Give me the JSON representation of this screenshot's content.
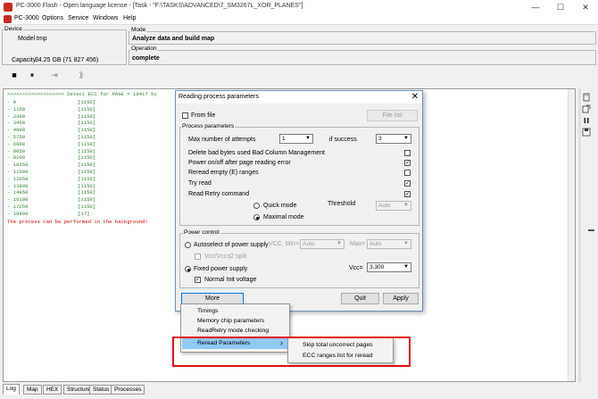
{
  "window": {
    "title": "PC-3000 Flash - Open language license - [Task - \"F:\\TASKS\\ADVANCED\\7_SM3267L_XOR_PLANES\"]",
    "minimize": "—",
    "maximize": "☐",
    "close": "✕"
  },
  "menubar": {
    "app_name": "PC-3000",
    "items": [
      "Options",
      "Service",
      "Windows",
      "Help"
    ]
  },
  "device": {
    "group_label": "Device",
    "model_label": "Model",
    "model_value": "tmp",
    "capacity_label": "Capacity",
    "capacity_value": "34.25 GB (71 827 456)"
  },
  "mode": {
    "group_label": "Mode",
    "value": "Analyze data and build map"
  },
  "operation": {
    "group_label": "Operation",
    "value": "complete"
  },
  "toolbar": {
    "stop": "■",
    "pause": "⏸",
    "step": "⇥",
    "run": "⟫"
  },
  "log": {
    "header": ">>>>>>>>>>>>>>>>>>> Detect ECC for PAGE = 18417 by",
    "rows": [
      {
        "n": "- 0",
        "v": "[1150]"
      },
      {
        "n": "- 1150",
        "v": "[1150]"
      },
      {
        "n": "- 2300",
        "v": "[1150]"
      },
      {
        "n": "- 3450",
        "v": "[1150]"
      },
      {
        "n": "- 4600",
        "v": "[1150]"
      },
      {
        "n": "- 5750",
        "v": "[1150]"
      },
      {
        "n": "- 6900",
        "v": "[1150]"
      },
      {
        "n": "- 8050",
        "v": "[1150]"
      },
      {
        "n": "- 9200",
        "v": "[1150]"
      },
      {
        "n": "- 10350",
        "v": "[1150]"
      },
      {
        "n": "- 11500",
        "v": "[1150]"
      },
      {
        "n": "- 12650",
        "v": "[1150]"
      },
      {
        "n": "- 13800",
        "v": "[1150]"
      },
      {
        "n": "- 14950",
        "v": "[1150]"
      },
      {
        "n": "- 16100",
        "v": "[1150]"
      },
      {
        "n": "- 17250",
        "v": "[1150]"
      },
      {
        "n": "- 18400",
        "v": "[17]"
      }
    ],
    "footer": "The process can be performed in the background!"
  },
  "bottom_tabs": [
    "Log",
    "Map",
    "HEX",
    "Structure",
    "Status",
    "Processes"
  ],
  "dialog": {
    "title": "Reading process parameters",
    "close": "✕",
    "from_file": "From file",
    "file_list": "File list",
    "process_params_label": "Process parameters",
    "max_attempts_label": "Max number of attempts",
    "max_attempts_value": "1",
    "if_success_label": "if success",
    "if_success_value": "3",
    "opt_delete_bad": "Delete bad bytes used Bad Column Management",
    "opt_power_onoff": "Power on/off after page reading error",
    "opt_reread_empty": "Reread empty (E) ranges",
    "opt_try_read": "Try read",
    "opt_read_retry": "Read Retry command",
    "quick_mode": "Quick mode",
    "threshold_label": "Threshold",
    "threshold_value": "Auto",
    "maximal_mode": "Maximal mode",
    "power_control_label": "Power control",
    "autoselect": "Autoselect of power supply",
    "vcc_min_label": "VCC, Min>",
    "vcc_min_value": "Auto",
    "max_label": "Max>",
    "max_value": "Auto",
    "vcc_split": "Vcc/Vccq2 split",
    "fixed_power": "Fixed power supply",
    "vcc_label": "Vcc=",
    "vcc_value": "3.300",
    "normal_init": "Normal Init voltage",
    "more": "More",
    "quit": "Quit",
    "apply": "Apply",
    "check_mark": "✓"
  },
  "more_menu": {
    "items": [
      "Timings",
      "Memory chip parameters",
      "ReadRetry mode checking",
      "Reread Parameters"
    ],
    "arrow": "›"
  },
  "submenu": {
    "items": [
      "Skip total uncorrect pages",
      "ECC ranges list for reread"
    ]
  },
  "colors": {
    "log_text": "#2e7d2e",
    "log_warning": "#d00000",
    "highlight_box": "#e01010",
    "menu_selection": "#91c9f7"
  }
}
